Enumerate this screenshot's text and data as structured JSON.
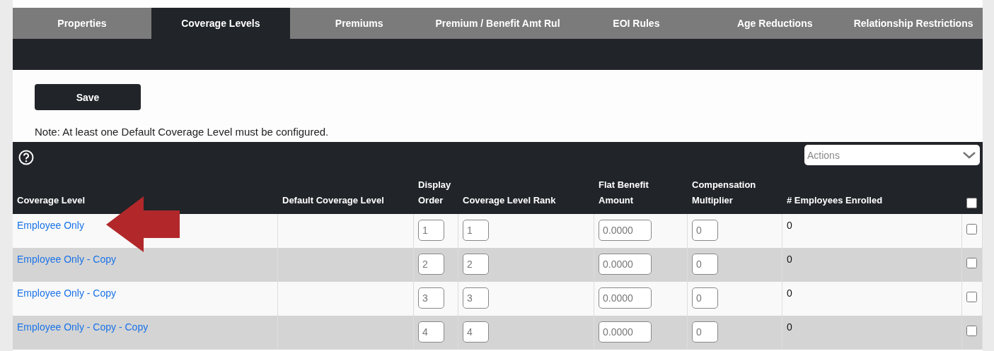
{
  "tabs": [
    {
      "label": "Properties",
      "selected": false
    },
    {
      "label": "Coverage Levels",
      "selected": true
    },
    {
      "label": "Premiums",
      "selected": false
    },
    {
      "label": "Premium / Benefit Amt Rul",
      "selected": false
    },
    {
      "label": "EOI Rules",
      "selected": false
    },
    {
      "label": "Age Reductions",
      "selected": false
    },
    {
      "label": "Relationship Restrictions",
      "selected": false
    }
  ],
  "save_button": "Save",
  "note": "Note: At least one Default Coverage Level must be configured.",
  "actions": {
    "placeholder": "Actions"
  },
  "table": {
    "columns": [
      {
        "bottom": "Coverage Level"
      },
      {
        "bottom": "Default Coverage Level"
      },
      {
        "top": "Display",
        "bottom": "Order"
      },
      {
        "bottom": "Coverage Level Rank"
      },
      {
        "top": "Flat Benefit",
        "bottom": "Amount"
      },
      {
        "top": "Compensation",
        "bottom": "Multiplier"
      },
      {
        "bottom": "# Employees Enrolled"
      }
    ],
    "select_all_checked": false,
    "rows": [
      {
        "coverage_level": "Employee Only",
        "display_order": "1",
        "rank": "1",
        "flat_benefit": "0.0000",
        "multiplier": "0",
        "enrolled": "0",
        "checked": false
      },
      {
        "coverage_level": "Employee Only - Copy",
        "display_order": "2",
        "rank": "2",
        "flat_benefit": "0.0000",
        "multiplier": "0",
        "enrolled": "0",
        "checked": false
      },
      {
        "coverage_level": "Employee Only - Copy",
        "display_order": "3",
        "rank": "3",
        "flat_benefit": "0.0000",
        "multiplier": "0",
        "enrolled": "0",
        "checked": false
      },
      {
        "coverage_level": "Employee Only - Copy - Copy",
        "display_order": "4",
        "rank": "4",
        "flat_benefit": "0.0000",
        "multiplier": "0",
        "enrolled": "0",
        "checked": false
      }
    ]
  }
}
